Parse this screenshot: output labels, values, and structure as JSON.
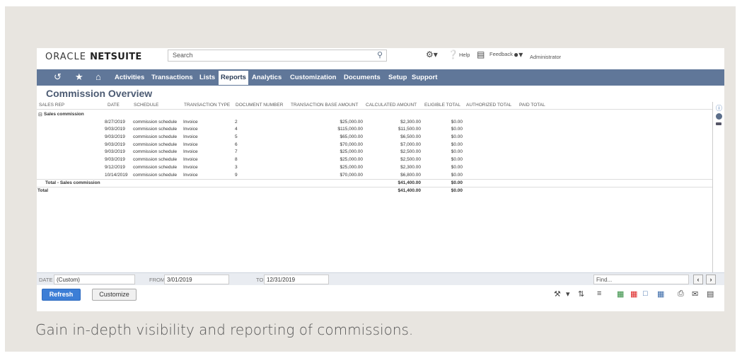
{
  "header": {
    "logo_light": "ORACLE",
    "logo_bold": "NETSUITE",
    "search_placeholder": "Search",
    "help": "Help",
    "feedback": "Feedback",
    "user": "Administrator"
  },
  "nav": {
    "items": [
      "Activities",
      "Transactions",
      "Lists",
      "Reports",
      "Analytics",
      "Customization",
      "Documents",
      "Setup",
      "Support"
    ],
    "active": "Reports"
  },
  "page": {
    "title": "Commission Overview"
  },
  "table": {
    "columns": [
      "SALES REP",
      "DATE",
      "SCHEDULE",
      "TRANSACTION TYPE",
      "DOCUMENT NUMBER",
      "TRANSACTION BASE AMOUNT",
      "CALCULATED AMOUNT",
      "ELIGIBLE TOTAL",
      "AUTHORIZED TOTAL",
      "PAID TOTAL"
    ],
    "group": "Sales commission",
    "rows": [
      {
        "date": "8/27/2019",
        "schedule": "commission schedule",
        "type": "Invoice",
        "doc": "2",
        "base": "$25,000.00",
        "calc": "$2,300.00",
        "eligible": "$0.00"
      },
      {
        "date": "9/03/2019",
        "schedule": "commission schedule",
        "type": "Invoice",
        "doc": "4",
        "base": "$115,000.00",
        "calc": "$11,500.00",
        "eligible": "$0.00"
      },
      {
        "date": "9/03/2019",
        "schedule": "commission schedule",
        "type": "Invoice",
        "doc": "5",
        "base": "$65,000.00",
        "calc": "$6,500.00",
        "eligible": "$0.00"
      },
      {
        "date": "9/03/2019",
        "schedule": "commission schedule",
        "type": "Invoice",
        "doc": "6",
        "base": "$70,000.00",
        "calc": "$7,000.00",
        "eligible": "$0.00"
      },
      {
        "date": "9/03/2019",
        "schedule": "commission schedule",
        "type": "Invoice",
        "doc": "7",
        "base": "$25,000.00",
        "calc": "$2,500.00",
        "eligible": "$0.00"
      },
      {
        "date": "9/03/2019",
        "schedule": "commission schedule",
        "type": "Invoice",
        "doc": "8",
        "base": "$25,000.00",
        "calc": "$2,500.00",
        "eligible": "$0.00"
      },
      {
        "date": "9/12/2019",
        "schedule": "commission schedule",
        "type": "Invoice",
        "doc": "3",
        "base": "$25,000.00",
        "calc": "$2,300.00",
        "eligible": "$0.00"
      },
      {
        "date": "10/14/2019",
        "schedule": "commission schedule",
        "type": "Invoice",
        "doc": "9",
        "base": "$70,000.00",
        "calc": "$6,800.00",
        "eligible": "$0.00"
      }
    ],
    "subtotal_label": "Total - Sales commission",
    "subtotal_calc": "$41,400.00",
    "subtotal_eligible": "$0.00",
    "total_label": "Total",
    "total_calc": "$41,400.00",
    "total_eligible": "$0.00"
  },
  "filters": {
    "date_label": "DATE",
    "date_value": "(Custom)",
    "from_label": "FROM",
    "from_value": "3/01/2019",
    "to_label": "TO",
    "to_value": "12/31/2019",
    "find_placeholder": "Find..."
  },
  "actions": {
    "refresh": "Refresh",
    "customize": "Customize"
  },
  "caption": "Gain in-depth visibility and reporting of commissions."
}
